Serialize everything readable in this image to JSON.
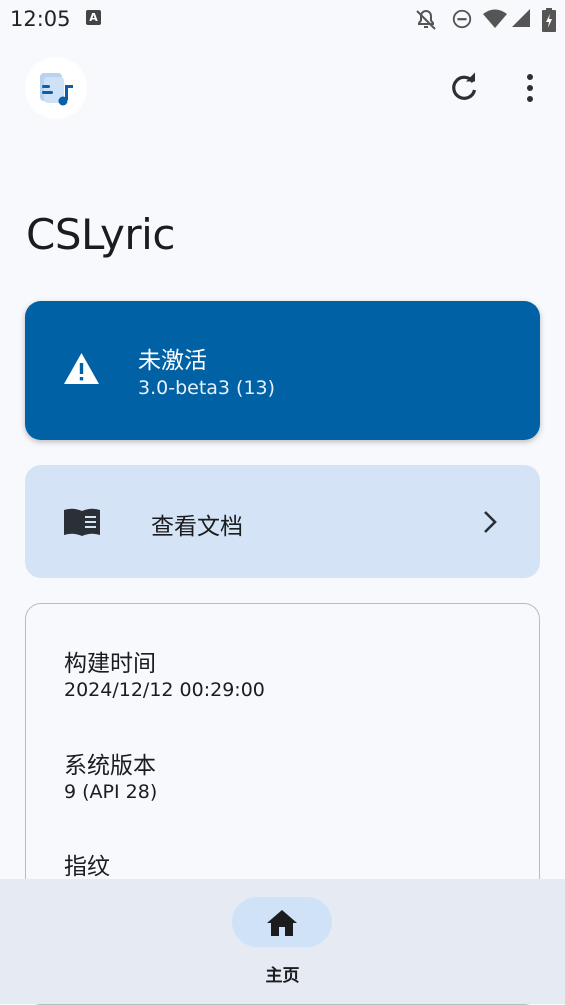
{
  "status_bar": {
    "time": "12:05",
    "badge": "A",
    "icons": [
      "notifications-off-icon",
      "do-not-disturb-icon",
      "wifi-icon",
      "cellular-signal-icon",
      "battery-icon"
    ]
  },
  "app_bar": {
    "logo_icon": "lyrics-app-logo-icon",
    "actions": [
      "refresh-icon",
      "more-vert-icon"
    ]
  },
  "page": {
    "title": "CSLyric"
  },
  "status_card": {
    "icon": "warning-icon",
    "title": "未激活",
    "version": "3.0-beta3 (13)",
    "color": "#0062a4"
  },
  "docs_card": {
    "icon": "book-icon",
    "label": "查看文档",
    "trailing_icon": "chevron-right-icon"
  },
  "info_card": {
    "items": [
      {
        "label": "构建时间",
        "value": "2024/12/12 00:29:00"
      },
      {
        "label": "系统版本",
        "value": "9 (API 28)"
      },
      {
        "label": "指纹",
        "value": ""
      }
    ]
  },
  "bottom_nav": {
    "items": [
      {
        "label": "主页",
        "icon": "home-icon",
        "selected": true
      }
    ]
  }
}
